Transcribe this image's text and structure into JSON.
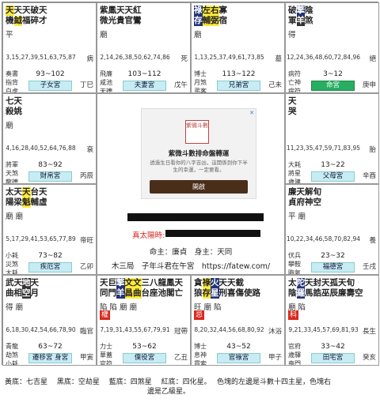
{
  "cells": [
    {
      "id": "si",
      "stars": [
        {
          "t": "天",
          "c": "hl-y"
        },
        {
          "t": "天"
        },
        {
          "t": "天"
        },
        {
          "t": "破"
        },
        {
          "t": "天"
        },
        {
          "t": "　"
        },
        {
          "t": "機"
        },
        {
          "t": "鉞",
          "c": "hl-y"
        },
        {
          "t": "福"
        },
        {
          "t": "碎"
        },
        {
          "t": "才"
        }
      ],
      "line1": "天天天破天",
      "line2": "機鉞福碎才",
      "bright": "平",
      "hua": "",
      "ages": "3,15,27,39,51,63,75,87",
      "stage": "病",
      "gods": [
        "奏書",
        "指背",
        "白虎"
      ],
      "range": "93~102",
      "palace": "子女宮",
      "stem": "丁巳",
      "main": false
    },
    {
      "id": "wu",
      "line1": "紫鳳天天紅",
      "line2": "微光貴官鸞",
      "bright": "廟",
      "hua": "",
      "ages": "2,14,26,38,50,62,74,86",
      "stage": "死",
      "gods": [
        "飛廉",
        "咸池",
        "天德"
      ],
      "range": "103~112",
      "palace": "夫妻宮",
      "stem": "戊午",
      "main": false
    },
    {
      "id": "wei",
      "line1": "祿左右寡",
      "line2": "存輔弼宿",
      "bright": "廟",
      "hua": "",
      "ages": "1,13,25,37,49,61,73,85",
      "stage": "墓",
      "gods": [
        "博士",
        "月煞",
        "弔客"
      ],
      "range": "113~122",
      "palace": "兄弟宮",
      "stem": "己未",
      "main": false
    },
    {
      "id": "shen",
      "line1": "破擎陰",
      "line2": "軍羊煞",
      "bright": "得",
      "hua": "得",
      "ages": "12,24,36,48,60,72,84,96",
      "stage": "絕",
      "gods": [
        "病符",
        "亡神",
        "病符"
      ],
      "range": "3~12",
      "palace": "命宮",
      "stem": "庚申",
      "main": true
    },
    {
      "id": "chen",
      "line1": "七天",
      "line2": "殺姚",
      "bright": "廟",
      "hua": "",
      "ages": "4,16,28,40,52,64,76,88",
      "stage": "衰",
      "gods": [
        "將軍",
        "天煞",
        "龍德"
      ],
      "range": "83~92",
      "palace": "財帛宮",
      "stem": "丙辰",
      "main": false
    },
    {
      "id": "you",
      "line1": "天",
      "line2": "哭",
      "bright": "",
      "hua": "",
      "ages": "11,23,35,47,59,71,83,95",
      "stage": "胎",
      "gods": [
        "大耗",
        "將星",
        "歲建"
      ],
      "range": "13~22",
      "palace": "父母宮",
      "stem": "辛酉",
      "main": false
    },
    {
      "id": "mao",
      "line1": "太天天台天",
      "line2": "陽梁魁輔虛",
      "bright": "廟 廟",
      "hua": "",
      "ages": "5,17,29,41,53,65,77,89",
      "stage": "帝旺",
      "gods": [
        "小耗",
        "災煞",
        "大耗"
      ],
      "range": "73~82",
      "palace": "疾厄宮",
      "stem": "乙卯",
      "main": false
    },
    {
      "id": "xu",
      "line1": "廉天解旬",
      "line2": "貞府神空",
      "bright": "平 廟",
      "hua": "",
      "ages": "10,22,34,46,58,70,82,94",
      "stage": "養",
      "gods": [
        "伏兵",
        "攀鞍",
        "晦氣"
      ],
      "range": "23~32",
      "palace": "福德宮",
      "stem": "壬戌",
      "main": false
    },
    {
      "id": "yin",
      "line1": "武天地天",
      "line2": "曲相空月",
      "bright": "得 廟",
      "hua": "",
      "ages": "6,18,30,42,54,66,78,90",
      "stage": "臨官",
      "gods": [
        "青龍",
        "劫煞",
        "小耗"
      ],
      "range": "63~72",
      "palace": "遷移宮 身宮",
      "stem": "甲寅",
      "main": false
    },
    {
      "id": "chou",
      "line1": "天巨擎文文三八龍鳳天",
      "line2": "同門羊昌曲台座池閣亡",
      "bright": "陷 陷 廟 廟",
      "hua": "權",
      "ages": "7,19,31,43,55,67,79,91",
      "stage": "冠帶",
      "gods": [
        "力士",
        "華蓋",
        "官符"
      ],
      "range": "53~62",
      "palace": "僕役宮",
      "stem": "乙丑",
      "main": false
    },
    {
      "id": "zi",
      "line1": "貪祿火天天截",
      "line2": "狼存星刑喜傷使路",
      "bright": "旺 廟 陷",
      "hua": "忌",
      "ages": "8,20,32,44,56,68,80,92",
      "stage": "沐浴",
      "gods": [
        "博士",
        "息神",
        "貫索"
      ],
      "range": "43~52",
      "palace": "官祿宮",
      "stem": "甲子",
      "main": false
    },
    {
      "id": "hai",
      "line1": "太陀天封天孤天旬",
      "line2": "陰羅馬誥巫辰廉壽空",
      "bright": "廟 陷",
      "hua": "科",
      "ages": "9,21,33,45,57,69,81,93",
      "stage": "長生",
      "gods": [
        "官府",
        "歲驛",
        "喪門"
      ],
      "range": "33~42",
      "palace": "田宅宮",
      "stem": "癸亥",
      "main": false
    }
  ],
  "center": {
    "ad_logo": "紫微斗數",
    "ad_title": "紫微斗數排命盤轉運",
    "ad_desc": "透過生日看你的八字吉凶，這開係到你下半生的幸運，一定要看。",
    "ad_button": "開啟",
    "ad_close": "✕",
    "solar_label": "真太陽時:",
    "ming_line": "命主：廉貞　身主：天同",
    "info_line": "木三局　子年斗君在午宮　https://fatew.com/"
  },
  "legend": {
    "line1": "黃底：七吉星　 黑底：空劫星　 藍底：四煞星　 紅底：四化星。　 色塊的左邊是斗數十四主星，色塊右",
    "line2": "邊是乙級星。"
  },
  "colors": {
    "yellow": "#ffeb3b",
    "blue": "#223377",
    "green": "#27ae60",
    "red": "#d9281d",
    "palace": "#c7ecf4"
  }
}
